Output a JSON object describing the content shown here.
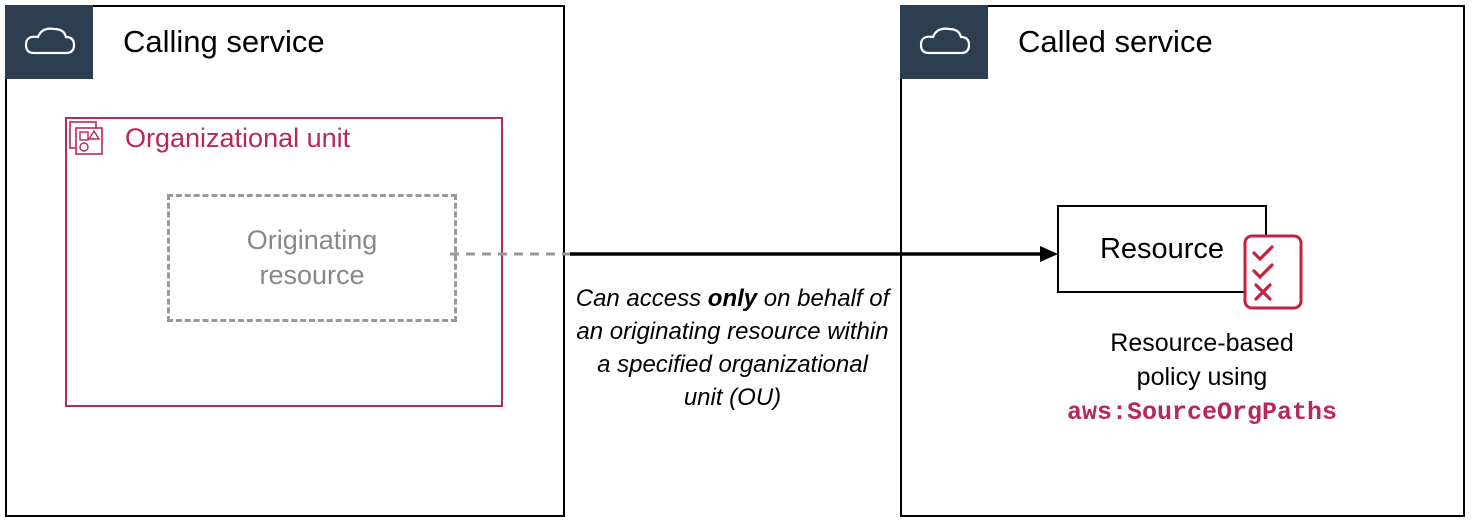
{
  "calling_service": {
    "title": "Calling service",
    "org_unit": {
      "title": "Organizational unit"
    },
    "originating": "Originating\nresource"
  },
  "called_service": {
    "title": "Called service",
    "resource": "Resource",
    "policy_line1": "Resource-based",
    "policy_line2": "policy using",
    "policy_code": "aws:SourceOrgPaths"
  },
  "caption": {
    "pre": "Can access ",
    "bold": "only",
    "post": " on behalf of an originating resource within a specified organizational unit (OU)"
  },
  "icons": {
    "cloud": "cloud-icon",
    "org": "org-unit-icon",
    "checklist": "policy-checklist-icon"
  }
}
